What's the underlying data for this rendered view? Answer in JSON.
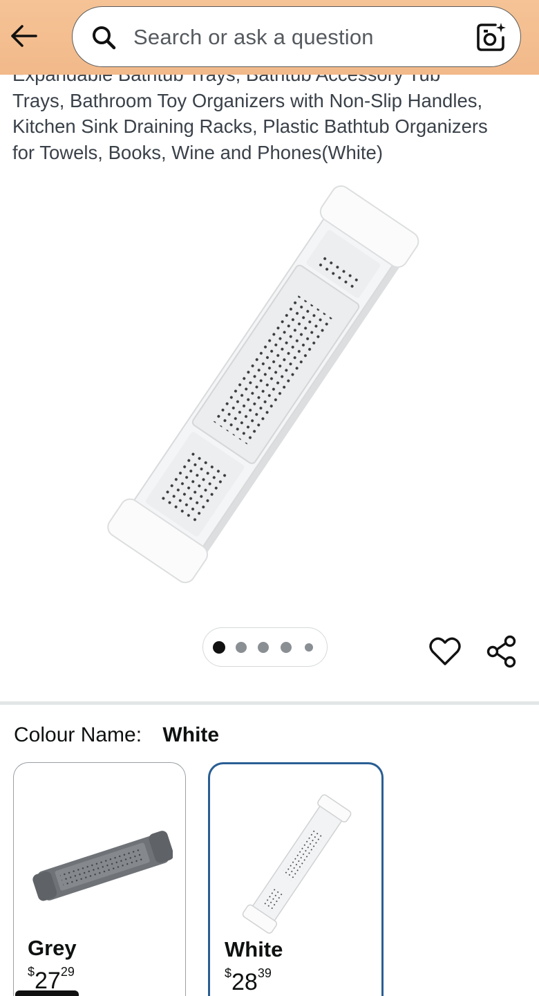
{
  "header": {
    "search_placeholder": "Search or ask a question"
  },
  "product": {
    "title_lines": [
      "Expandable Bathtub Trays, Bathtub Accessory Tub",
      "Trays, Bathroom Toy Organizers with Non-Slip Handles,",
      "Kitchen Sink Draining Racks, Plastic Bathtub Organizers",
      "for Towels, Books, Wine and Phones(White)"
    ],
    "image_count": 5,
    "active_image_index": 0
  },
  "variation": {
    "label": "Colour Name:",
    "selected_value": "White",
    "options": [
      {
        "name": "Grey",
        "price_symbol": "$",
        "price_whole": "27",
        "price_fraction": "29",
        "selected": false
      },
      {
        "name": "White",
        "price_symbol": "$",
        "price_whole": "28",
        "price_fraction": "39",
        "selected": true
      }
    ]
  },
  "colors": {
    "header_bg": "#f3bd8f",
    "selected_border": "#2a5e93",
    "grey_product": "#6f7378",
    "white_product": "#f2f3f4"
  }
}
